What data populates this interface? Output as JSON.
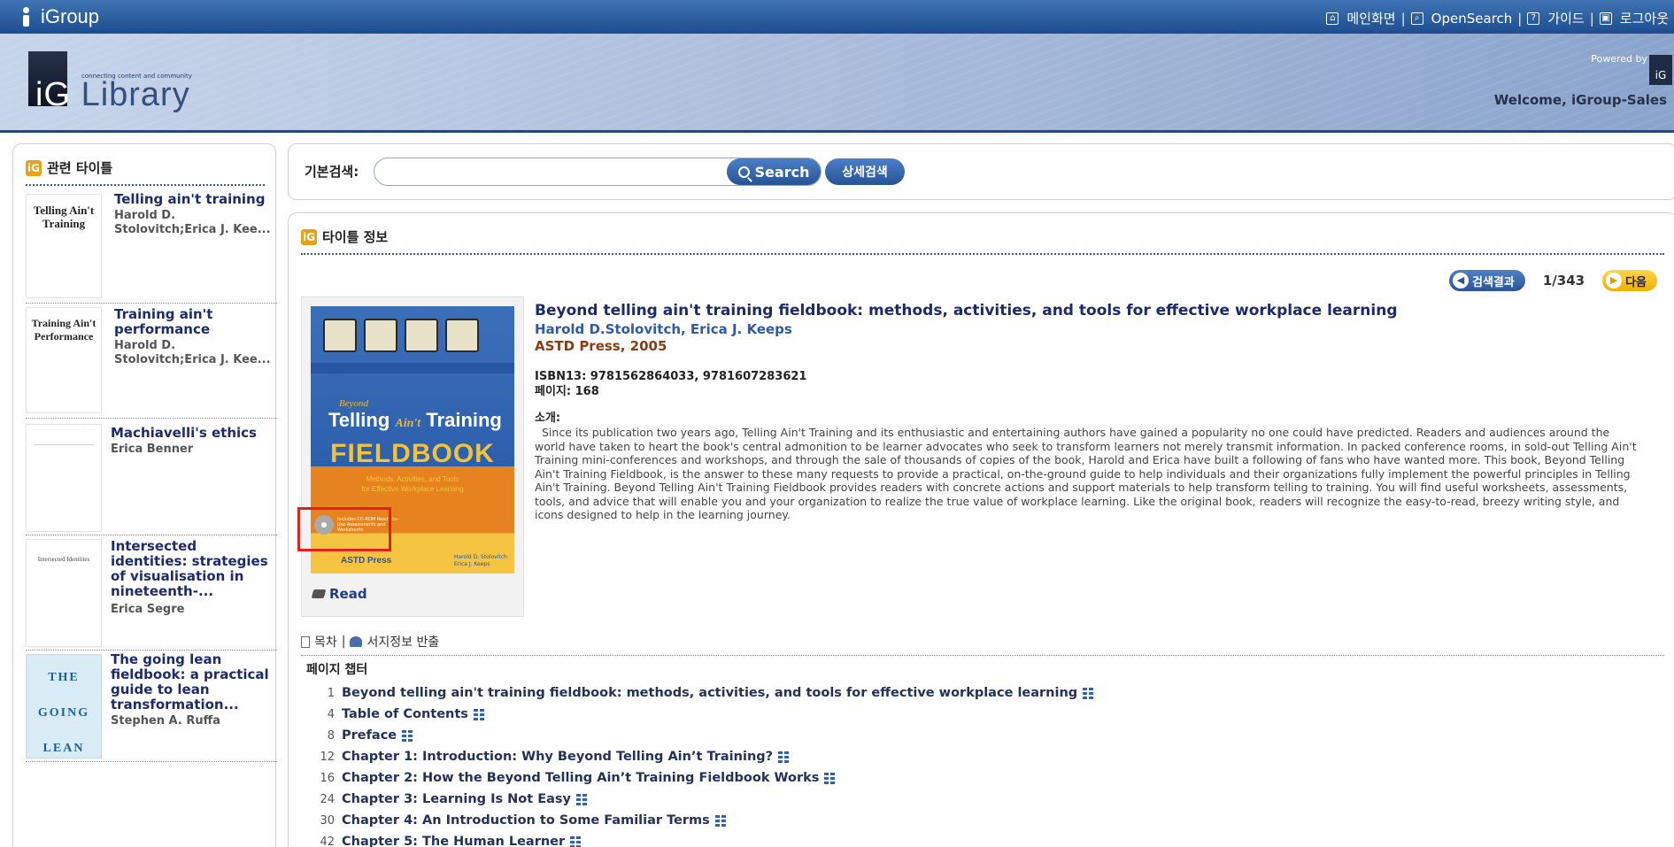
{
  "topbar": {
    "brand": "iGroup",
    "links": [
      "메인화면",
      "OpenSearch",
      "가이드",
      "로그아웃"
    ],
    "separator": "|"
  },
  "header": {
    "logo_tagline": "connecting content and community",
    "logo_ig": "iG",
    "logo_library": "Library",
    "powered_by": "Powered by",
    "powered_logo": "iG",
    "welcome": "Welcome, iGroup-Sales"
  },
  "sidebar": {
    "title": "관련 타이틀",
    "items": [
      {
        "title": "Telling ain't training",
        "author": "Harold D. Stolovitch;Erica J. Kee...",
        "thumb": "Telling Ain't Training"
      },
      {
        "title": "Training ain't performance",
        "author": "Harold D. Stolovitch;Erica J. Kee...",
        "thumb": "Training Ain't Performance"
      },
      {
        "title": "Machiavelli's ethics",
        "author": "Erica Benner",
        "thumb": ""
      },
      {
        "title": "Intersected identities: strategies of visualisation in nineteenth-...",
        "author": "Erica Segre",
        "thumb": "Intersected Identities"
      },
      {
        "title": "The going lean fieldbook: a practical guide to lean transformation...",
        "author": "Stephen A. Ruffa",
        "thumb": "THE GOING LEAN"
      }
    ]
  },
  "search": {
    "label": "기본검색:",
    "value": "",
    "button": "Search",
    "advanced": "상세검색"
  },
  "main": {
    "title": "타이틀 정보",
    "back_button": "검색결과",
    "pager": "1/343",
    "next_button": "다음",
    "read_label": "Read",
    "cover": {
      "beyond": "Beyond",
      "telling": "Telling",
      "aint": "Ain't",
      "training": "Training",
      "fieldbook": "FIELDBOOK",
      "subtitle1": "Methods, Activities, and Tools",
      "subtitle2": "for Effective Workplace Learning",
      "cd": "Includes CD-ROM Ready-to-Use Assessments and Worksheets",
      "publisher": "ASTD Press",
      "author1": "Harold D. Stolovitch",
      "author2": "Erica J. Keeps"
    },
    "book": {
      "title": "Beyond telling ain't training fieldbook: methods, activities, and tools for effective workplace learning",
      "authors": "Harold D.Stolovitch, Erica J. Keeps",
      "publisher": "ASTD Press, 2005",
      "isbn": "ISBN13: 9781562864033, 9781607283621",
      "pages": "페이지: 168",
      "intro_label": "소개:",
      "intro": "Since its publication two years ago, Telling Ain't Training and its enthusiastic and entertaining authors have gained a popularity no one could have predicted. Readers and audiences around the world have taken to heart the book's central admonition to be learner advocates who seek to transform learners not merely transmit information. In packed conference rooms, in sold-out Telling Ain't Training mini-conferences and workshops, and through the sale of thousands of copies of the book, Harold and Erica have built a following of fans who have wanted more. This book, Beyond Telling Ain't Training Fieldbook, is the answer to these many requests to provide a practical, on-the-ground guide to help individuals and their organizations fully implement the powerful principles in Telling Ain't Training. Beyond Telling Ain't Training Fieldbook provides readers with concrete actions and support materials to help transform telling to training. You will find useful worksheets, assessments, tools, and advice that will enable you and your organization to realize the true value of workplace learning. Like the original book, readers will recognize the easy-to-read, breezy writing style, and icons designed to help in the learning journey."
    },
    "toc": {
      "tab_toc": "목차",
      "tab_export": "서지정보 반출",
      "separator": "|",
      "col_page": "페이지",
      "col_chapter": "챕터",
      "rows": [
        {
          "page": "1",
          "chapter": "Beyond telling ain't training fieldbook: methods, activities, and tools for effective workplace learning"
        },
        {
          "page": "4",
          "chapter": "Table of Contents"
        },
        {
          "page": "8",
          "chapter": "Preface"
        },
        {
          "page": "12",
          "chapter": "Chapter 1: Introduction: Why Beyond Telling Ain’t Training?"
        },
        {
          "page": "16",
          "chapter": "Chapter 2: How the Beyond Telling Ain’t Training Fieldbook Works"
        },
        {
          "page": "24",
          "chapter": "Chapter 3: Learning Is Not Easy"
        },
        {
          "page": "30",
          "chapter": "Chapter 4: An Introduction to Some Familiar Terms"
        },
        {
          "page": "42",
          "chapter": "Chapter 5: The Human Learner"
        }
      ]
    }
  },
  "colors": {
    "topbar": "#2a5b9e",
    "title_link": "#1c2b6d",
    "author_link": "#2f5aa8",
    "publisher": "#8b3a12",
    "highlight": "#e2211c",
    "next_button": "#f5c000"
  }
}
